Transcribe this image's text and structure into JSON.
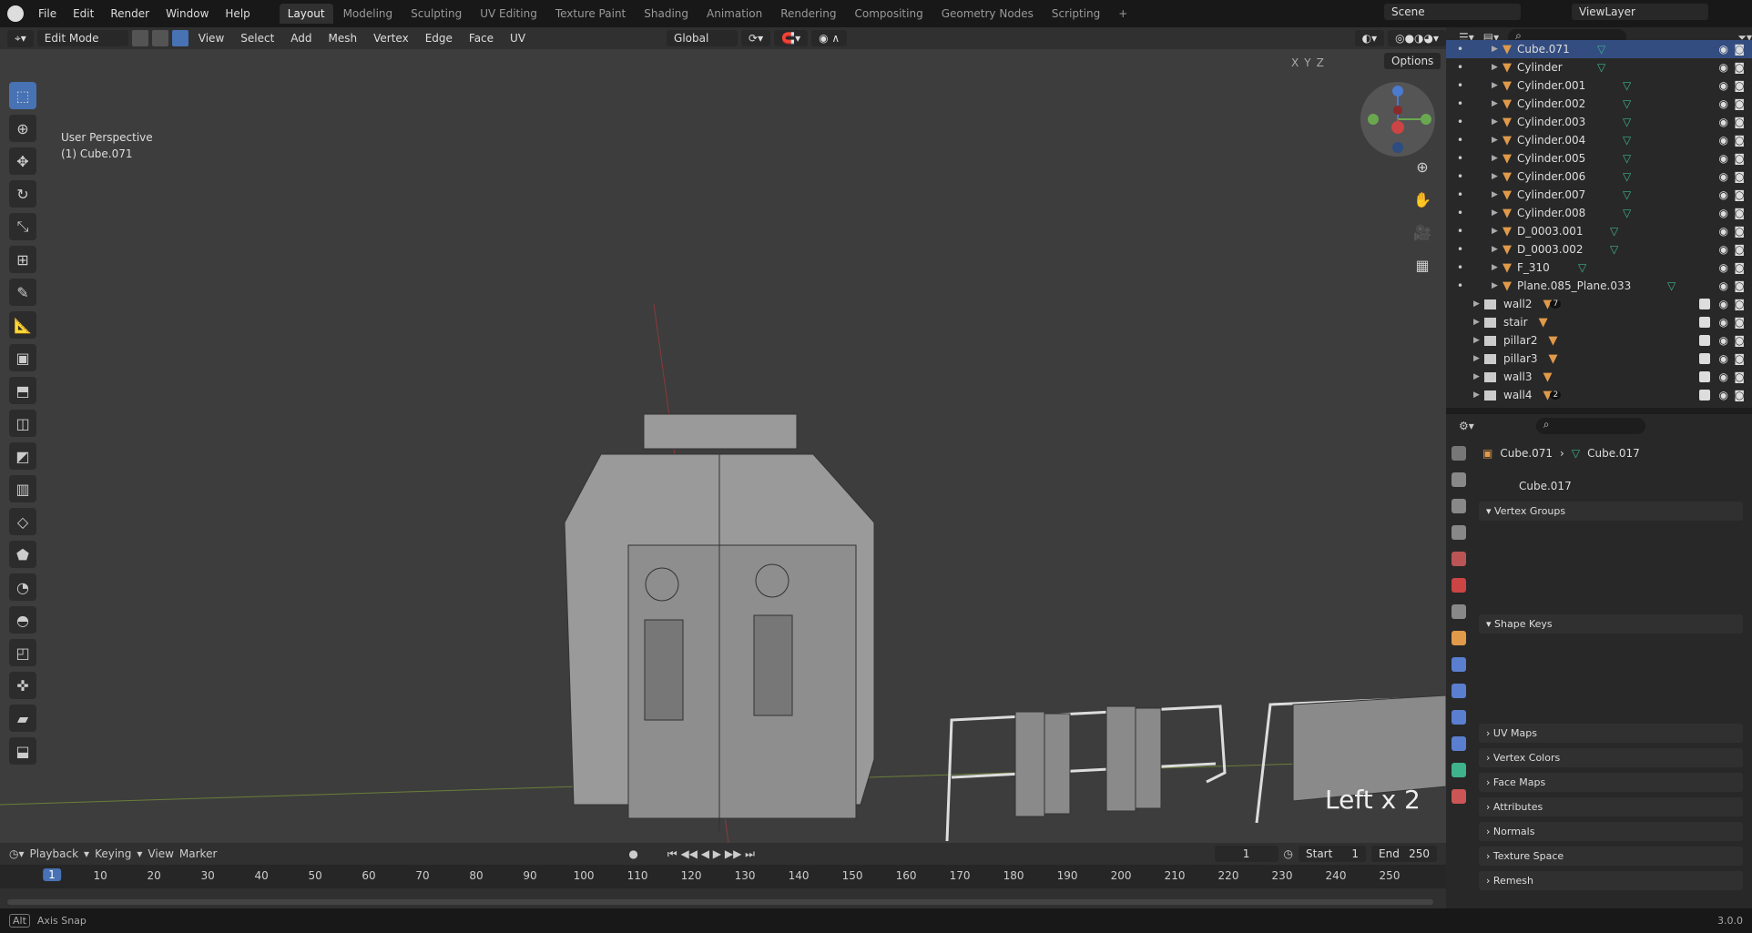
{
  "menu": [
    "File",
    "Edit",
    "Render",
    "Window",
    "Help"
  ],
  "workspaces": [
    "Layout",
    "Modeling",
    "Sculpting",
    "UV Editing",
    "Texture Paint",
    "Shading",
    "Animation",
    "Rendering",
    "Compositing",
    "Geometry Nodes",
    "Scripting",
    "+"
  ],
  "active_workspace": "Layout",
  "scene": "Scene",
  "view_layer": "ViewLayer",
  "viewport_header": {
    "mode": "Edit Mode",
    "menus": [
      "View",
      "Select",
      "Add",
      "Mesh",
      "Vertex",
      "Edge",
      "Face",
      "UV"
    ],
    "orientation": "Global",
    "options": "Options",
    "axes": [
      "X",
      "Y",
      "Z"
    ]
  },
  "viewport": {
    "perspective": "User Perspective",
    "object": "(1) Cube.071",
    "operator": "Left x 2"
  },
  "outliner": {
    "items": [
      {
        "name": "Cube.071",
        "type": "mesh",
        "selected": true
      },
      {
        "name": "Cylinder",
        "type": "mesh"
      },
      {
        "name": "Cylinder.001",
        "type": "mesh"
      },
      {
        "name": "Cylinder.002",
        "type": "mesh"
      },
      {
        "name": "Cylinder.003",
        "type": "mesh"
      },
      {
        "name": "Cylinder.004",
        "type": "mesh"
      },
      {
        "name": "Cylinder.005",
        "type": "mesh"
      },
      {
        "name": "Cylinder.006",
        "type": "mesh"
      },
      {
        "name": "Cylinder.007",
        "type": "mesh"
      },
      {
        "name": "Cylinder.008",
        "type": "mesh"
      },
      {
        "name": "D_0003.001",
        "type": "mesh"
      },
      {
        "name": "D_0003.002",
        "type": "mesh"
      },
      {
        "name": "F_310",
        "type": "mesh"
      },
      {
        "name": "Plane.085_Plane.033",
        "type": "mesh"
      },
      {
        "name": "wall2",
        "type": "collection",
        "badge": "7"
      },
      {
        "name": "stair",
        "type": "collection"
      },
      {
        "name": "pillar2",
        "type": "collection"
      },
      {
        "name": "pillar3",
        "type": "collection"
      },
      {
        "name": "wall3",
        "type": "collection"
      },
      {
        "name": "wall4",
        "type": "collection",
        "badge": "2"
      }
    ]
  },
  "properties": {
    "breadcrumb_object": "Cube.071",
    "breadcrumb_data": "Cube.017",
    "mesh_name": "Cube.017",
    "panels": [
      "Vertex Groups",
      "Shape Keys",
      "UV Maps",
      "Vertex Colors",
      "Face Maps",
      "Attributes",
      "Normals",
      "Texture Space",
      "Remesh"
    ]
  },
  "timeline": {
    "menus": [
      "Playback",
      "Keying",
      "View",
      "Marker"
    ],
    "current_frame": "1",
    "start_label": "Start",
    "start": "1",
    "end_label": "End",
    "end": "250",
    "ticks": [
      "10",
      "20",
      "30",
      "40",
      "50",
      "60",
      "70",
      "80",
      "90",
      "100",
      "110",
      "120",
      "130",
      "140",
      "150",
      "160",
      "170",
      "180",
      "190",
      "200",
      "210",
      "220",
      "230",
      "240",
      "250"
    ]
  },
  "status": {
    "key": "Alt",
    "hint": "Axis Snap",
    "version": "3.0.0"
  },
  "colors": {
    "accent": "#4772b3",
    "mesh": "#e09a4a",
    "data": "#3fb38c"
  }
}
